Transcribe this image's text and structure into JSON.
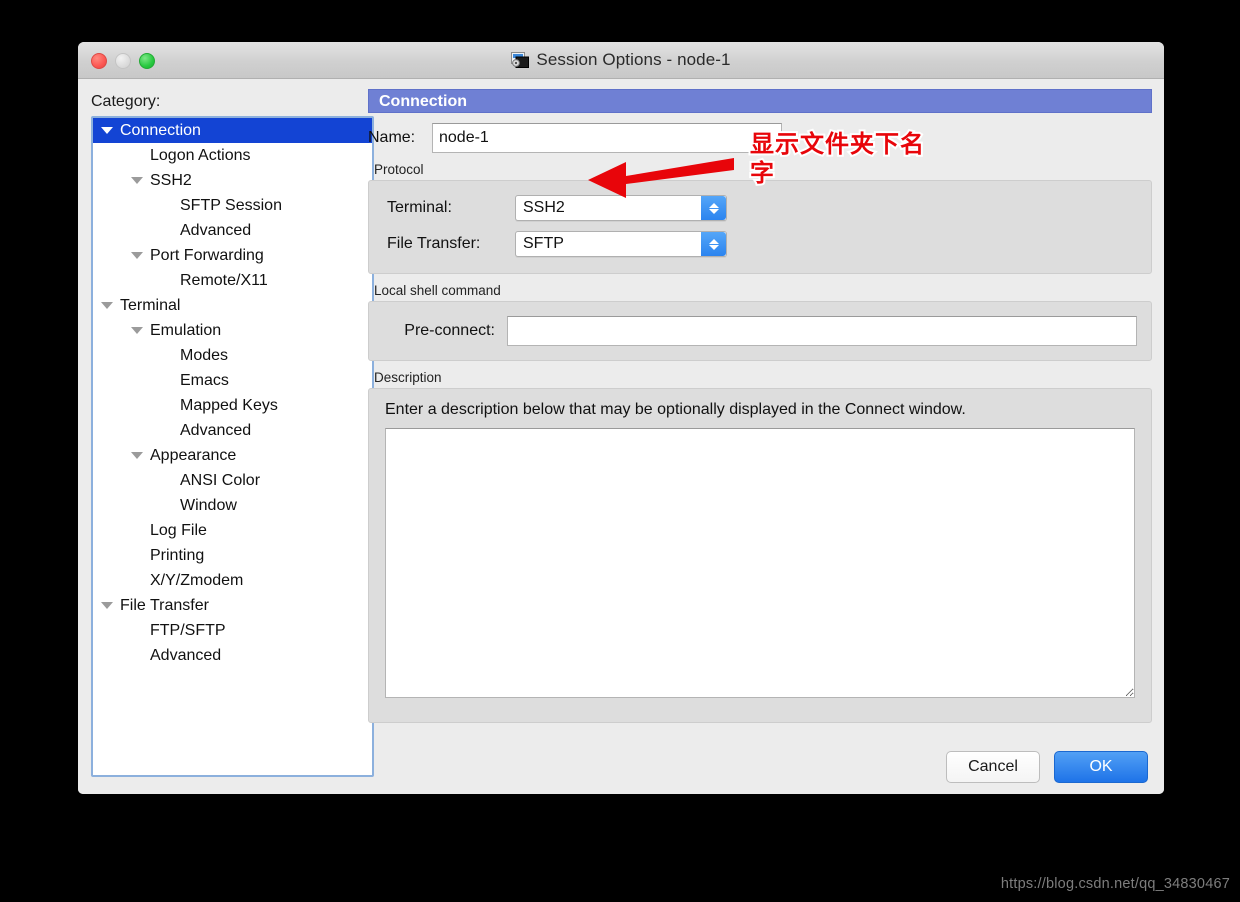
{
  "window": {
    "title": "Session Options - node-1",
    "icon": "session-window-icon",
    "traffic_lights": [
      "close",
      "minimize",
      "zoom"
    ]
  },
  "sidebar": {
    "label": "Category:",
    "items": [
      {
        "label": "Connection",
        "indent": 0,
        "expandable": true,
        "selected": true
      },
      {
        "label": "Logon Actions",
        "indent": 1,
        "expandable": false,
        "selected": false
      },
      {
        "label": "SSH2",
        "indent": 1,
        "expandable": true,
        "selected": false
      },
      {
        "label": "SFTP Session",
        "indent": 2,
        "expandable": false,
        "selected": false
      },
      {
        "label": "Advanced",
        "indent": 2,
        "expandable": false,
        "selected": false
      },
      {
        "label": "Port Forwarding",
        "indent": 1,
        "expandable": true,
        "selected": false
      },
      {
        "label": "Remote/X11",
        "indent": 2,
        "expandable": false,
        "selected": false
      },
      {
        "label": "Terminal",
        "indent": 0,
        "expandable": true,
        "selected": false
      },
      {
        "label": "Emulation",
        "indent": 1,
        "expandable": true,
        "selected": false
      },
      {
        "label": "Modes",
        "indent": 2,
        "expandable": false,
        "selected": false
      },
      {
        "label": "Emacs",
        "indent": 2,
        "expandable": false,
        "selected": false
      },
      {
        "label": "Mapped Keys",
        "indent": 2,
        "expandable": false,
        "selected": false
      },
      {
        "label": "Advanced",
        "indent": 2,
        "expandable": false,
        "selected": false
      },
      {
        "label": "Appearance",
        "indent": 1,
        "expandable": true,
        "selected": false
      },
      {
        "label": "ANSI Color",
        "indent": 2,
        "expandable": false,
        "selected": false
      },
      {
        "label": "Window",
        "indent": 2,
        "expandable": false,
        "selected": false
      },
      {
        "label": "Log File",
        "indent": 1,
        "expandable": false,
        "selected": false
      },
      {
        "label": "Printing",
        "indent": 1,
        "expandable": false,
        "selected": false
      },
      {
        "label": "X/Y/Zmodem",
        "indent": 1,
        "expandable": false,
        "selected": false
      },
      {
        "label": "File Transfer",
        "indent": 0,
        "expandable": true,
        "selected": false
      },
      {
        "label": "FTP/SFTP",
        "indent": 1,
        "expandable": false,
        "selected": false
      },
      {
        "label": "Advanced",
        "indent": 1,
        "expandable": false,
        "selected": false
      }
    ]
  },
  "pane": {
    "header": "Connection",
    "name": {
      "label": "Name:",
      "value": "node-1",
      "placeholder": ""
    },
    "protocol": {
      "group_title": "Protocol",
      "terminal": {
        "label": "Terminal:",
        "value": "SSH2"
      },
      "file_transfer": {
        "label": "File Transfer:",
        "value": "SFTP"
      }
    },
    "local_shell": {
      "group_title": "Local shell command",
      "pre_connect": {
        "label": "Pre-connect:",
        "value": "",
        "placeholder": ""
      }
    },
    "description": {
      "group_title": "Description",
      "hint": "Enter a description below that may be optionally displayed in the Connect window.",
      "value": "",
      "placeholder": ""
    }
  },
  "footer": {
    "cancel_label": "Cancel",
    "ok_label": "OK"
  },
  "annotation": {
    "line1": "显示文件夹下名",
    "line2": "字",
    "color": "#e8050a",
    "arrow": "left-arrow-icon"
  },
  "watermark": "https://blog.csdn.net/qq_34830467",
  "colors": {
    "selection_blue": "#1344d4",
    "pane_header": "#6f80d4",
    "primary_button": "#1e73e8",
    "annotation_red": "#e8050a",
    "tree_focus_border": "#8cb0dd"
  }
}
